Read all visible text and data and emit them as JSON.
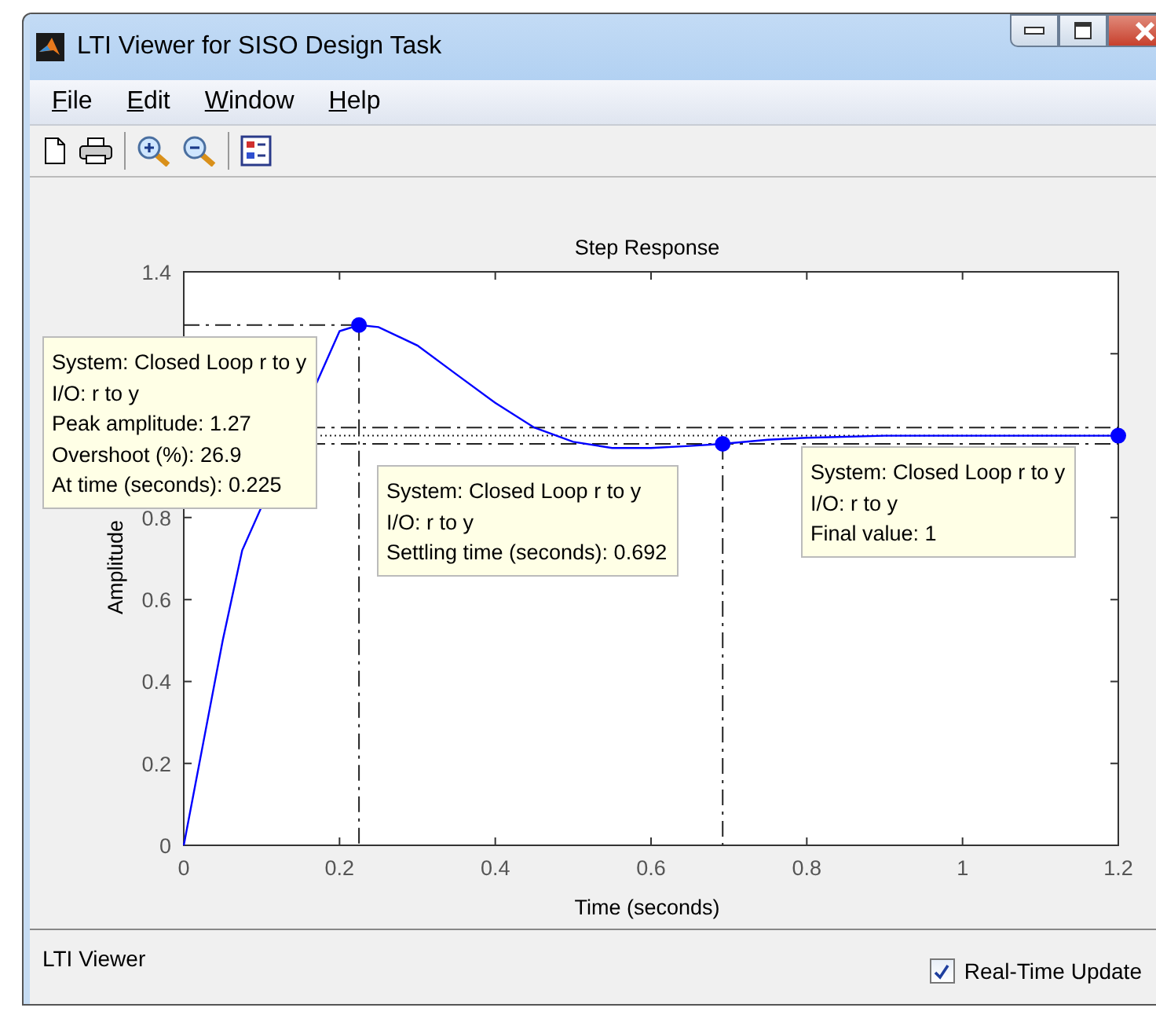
{
  "window": {
    "title": "LTI Viewer for SISO Design Task"
  },
  "menu": [
    "File",
    "Edit",
    "Window",
    "Help"
  ],
  "plot": {
    "chart_data": {
      "type": "line",
      "title": "Step Response",
      "xlabel": "Time (seconds)",
      "ylabel": "Amplitude",
      "x": [
        0,
        0.025,
        0.05,
        0.075,
        0.2,
        0.225,
        0.25,
        0.3,
        0.35,
        0.4,
        0.45,
        0.5,
        0.55,
        0.6,
        0.65,
        0.692,
        0.75,
        0.8,
        0.9,
        1,
        1.1,
        1.2
      ],
      "series": [
        {
          "color": "#0000ff",
          "values": [
            0,
            0.25,
            0.5,
            0.72,
            1.255,
            1.27,
            1.265,
            1.22,
            1.15,
            1.08,
            1.02,
            0.985,
            0.97,
            0.97,
            0.975,
            0.98,
            0.99,
            0.995,
            1,
            1,
            1,
            1
          ]
        }
      ],
      "xlim": [
        0,
        1.2
      ],
      "ylim": [
        0,
        1.4
      ],
      "xticks": [
        {
          "value": 0,
          "label": "0"
        },
        {
          "value": 0.2,
          "label": "0.2"
        },
        {
          "value": 0.4,
          "label": "0.4"
        },
        {
          "value": 0.6,
          "label": "0.6"
        },
        {
          "value": 0.8,
          "label": "0.8"
        },
        {
          "value": 1,
          "label": "1"
        },
        {
          "value": 1.2,
          "label": "1.2"
        }
      ],
      "yticks": [
        {
          "value": 0,
          "label": "0"
        },
        {
          "value": 0.2,
          "label": "0.2"
        },
        {
          "value": 0.4,
          "label": "0.4"
        },
        {
          "value": 0.6,
          "label": "0.6"
        },
        {
          "value": 0.8,
          "label": "0.8"
        },
        {
          "value": 1.4,
          "label": "1.4"
        }
      ],
      "ref_lines": [
        {
          "axis": "x",
          "value": 0.692
        }
      ]
    },
    "datatips": [
      {
        "kind": "peak",
        "lines": [
          "System: Closed Loop r to y",
          "I/O: r to y",
          "Peak amplitude: 1.27",
          "Overshoot (%): 26.9",
          "At time (seconds): 0.225"
        ]
      },
      {
        "kind": "settling",
        "lines": [
          "System: Closed Loop r to y",
          "I/O: r to y",
          "Settling time (seconds): 0.692"
        ]
      },
      {
        "kind": "final",
        "lines": [
          "System: Closed Loop r to y",
          "I/O: r to y",
          "Final value: 1"
        ]
      }
    ]
  },
  "status_bar": {
    "text": "LTI Viewer",
    "checkbox": {
      "label": "Real-Time Update",
      "checked": true
    }
  }
}
